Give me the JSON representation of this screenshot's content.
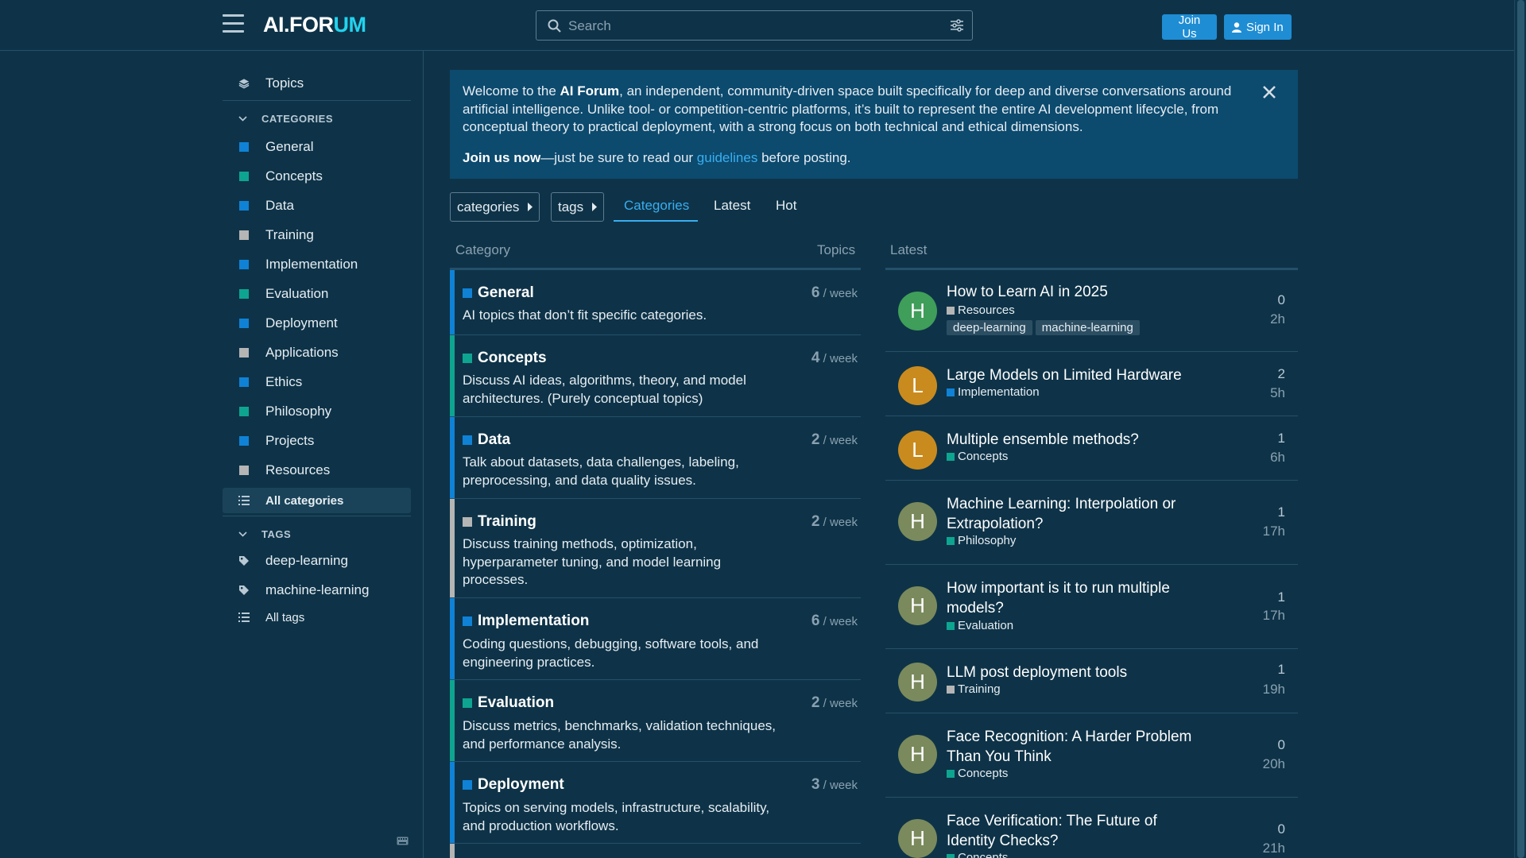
{
  "header": {
    "logo_main": "AI.FOR",
    "logo_accent": "UM",
    "search_placeholder": "Search",
    "join_label": "Join Us",
    "signin_label": "Sign In"
  },
  "sidebar": {
    "topics_label": "Topics",
    "categories_header": "CATEGORIES",
    "categories": [
      {
        "label": "General",
        "color": "#0f82d6"
      },
      {
        "label": "Concepts",
        "color": "#0ea590"
      },
      {
        "label": "Data",
        "color": "#0f82d6"
      },
      {
        "label": "Training",
        "color": "#b5b5b5"
      },
      {
        "label": "Implementation",
        "color": "#0f82d6"
      },
      {
        "label": "Evaluation",
        "color": "#0ea590"
      },
      {
        "label": "Deployment",
        "color": "#0f82d6"
      },
      {
        "label": "Applications",
        "color": "#b5b5b5"
      },
      {
        "label": "Ethics",
        "color": "#0f82d6"
      },
      {
        "label": "Philosophy",
        "color": "#0ea590"
      },
      {
        "label": "Projects",
        "color": "#0f82d6"
      },
      {
        "label": "Resources",
        "color": "#b5b5b5"
      }
    ],
    "all_categories_label": "All categories",
    "tags_header": "TAGS",
    "tags": [
      "deep-learning",
      "machine-learning"
    ],
    "all_tags_label": "All tags"
  },
  "banner": {
    "p1_before": "Welcome to the ",
    "p1_bold": "AI Forum",
    "p1_after": ", an independent, community-driven space built specifically for deep and diverse conversations around artificial intelligence. Unlike tool- or competition-centric platforms, it’s built to represent the entire AI development lifecycle, from conceptual theory to practical deployment, with a strong focus on both technical and ethical dimensions.",
    "p2_bold": "Join us now",
    "p2_middle": "—just be sure to read our ",
    "p2_link": "guidelines",
    "p2_after": " before posting."
  },
  "nav": {
    "categories_drop": "categories",
    "tags_drop": "tags",
    "tabs": [
      "Categories",
      "Latest",
      "Hot"
    ]
  },
  "category_table": {
    "col_category": "Category",
    "col_topics": "Topics",
    "per_label": "/ week",
    "rows": [
      {
        "name": "General",
        "color": "#0f82d6",
        "desc": "AI topics that don’t fit specific categories.",
        "count": "6"
      },
      {
        "name": "Concepts",
        "color": "#0ea590",
        "desc": "Discuss AI ideas, algorithms, theory, and model architectures. (Purely conceptual topics)",
        "count": "4"
      },
      {
        "name": "Data",
        "color": "#0f82d6",
        "desc": "Talk about datasets, data challenges, labeling, preprocessing, and data quality issues.",
        "count": "2"
      },
      {
        "name": "Training",
        "color": "#b5b5b5",
        "desc": "Discuss training methods, optimization, hyperparameter tuning, and model learning processes.",
        "count": "2"
      },
      {
        "name": "Implementation",
        "color": "#0f82d6",
        "desc": "Coding questions, debugging, software tools, and engineering practices.",
        "count": "6"
      },
      {
        "name": "Evaluation",
        "color": "#0ea590",
        "desc": "Discuss metrics, benchmarks, validation techniques, and performance analysis.",
        "count": "2"
      },
      {
        "name": "Deployment",
        "color": "#0f82d6",
        "desc": "Topics on serving models, infrastructure, scalability, and production workflows.",
        "count": "3"
      }
    ]
  },
  "latest": {
    "col_latest": "Latest",
    "topics": [
      {
        "avatar": "H",
        "avatar_color": "#3f9e59",
        "title": "How to Learn AI in 2025",
        "category": "Resources",
        "cat_color": "#b5b5b5",
        "tags": [
          "deep-learning",
          "machine-learning"
        ],
        "replies": "0",
        "age": "2h"
      },
      {
        "avatar": "L",
        "avatar_color": "#c98b1e",
        "title": "Large Models on Limited Hardware",
        "category": "Implementation",
        "cat_color": "#0f82d6",
        "tags": [],
        "replies": "2",
        "age": "5h"
      },
      {
        "avatar": "L",
        "avatar_color": "#c98b1e",
        "title": "Multiple ensemble methods?",
        "category": "Concepts",
        "cat_color": "#0ea590",
        "tags": [],
        "replies": "1",
        "age": "6h"
      },
      {
        "avatar": "H",
        "avatar_color": "#7a8a5c",
        "title": "Machine Learning: Interpolation or Extrapolation?",
        "category": "Philosophy",
        "cat_color": "#0ea590",
        "tags": [],
        "replies": "1",
        "age": "17h"
      },
      {
        "avatar": "H",
        "avatar_color": "#7a8a5c",
        "title": "How important is it to run multiple models?",
        "category": "Evaluation",
        "cat_color": "#0ea590",
        "tags": [],
        "replies": "1",
        "age": "17h"
      },
      {
        "avatar": "H",
        "avatar_color": "#7a8a5c",
        "title": "LLM post deployment tools",
        "category": "Training",
        "cat_color": "#b5b5b5",
        "tags": [],
        "replies": "1",
        "age": "19h"
      },
      {
        "avatar": "H",
        "avatar_color": "#7a8a5c",
        "title": "Face Recognition: A Harder Problem Than You Think",
        "category": "Concepts",
        "cat_color": "#0ea590",
        "tags": [],
        "replies": "0",
        "age": "20h"
      },
      {
        "avatar": "H",
        "avatar_color": "#7a8a5c",
        "title": "Face Verification: The Future of Identity Checks?",
        "category": "Concepts",
        "cat_color": "#0ea590",
        "tags": [],
        "replies": "0",
        "age": "21h"
      }
    ]
  }
}
